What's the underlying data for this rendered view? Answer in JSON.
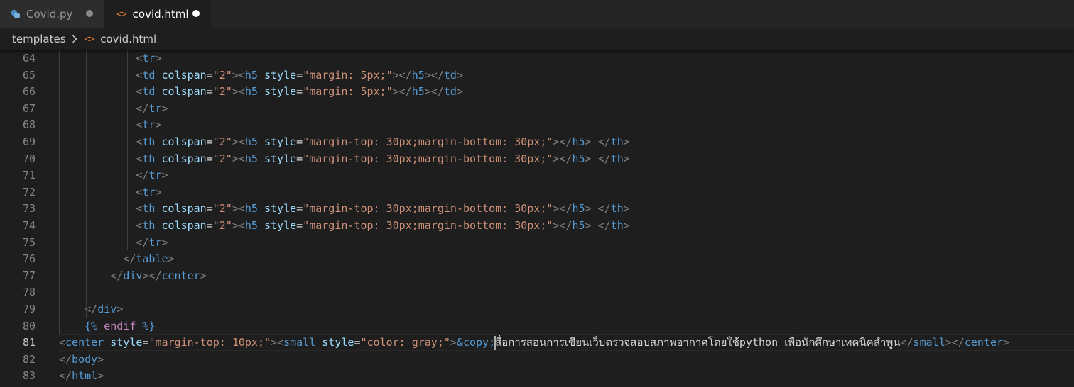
{
  "tabs": [
    {
      "label": "Covid.py",
      "icon": "python-file-icon",
      "active": false,
      "dirty": true
    },
    {
      "label": "covid.html",
      "icon": "html-file-icon",
      "active": true,
      "dirty": true
    }
  ],
  "breadcrumb": {
    "folder": "templates",
    "file": "covid.html"
  },
  "icons": {
    "html": "<>"
  },
  "editor": {
    "current_line": 81,
    "lines": [
      {
        "n": "64",
        "indent": 12,
        "tokens": [
          [
            "p",
            "<"
          ],
          [
            "tag",
            "tr"
          ],
          [
            "p",
            ">"
          ]
        ]
      },
      {
        "n": "65",
        "indent": 12,
        "tokens": [
          [
            "p",
            "<"
          ],
          [
            "tag",
            "td"
          ],
          [
            "t",
            " "
          ],
          [
            "attr",
            "colspan"
          ],
          [
            "t",
            "="
          ],
          [
            "str",
            "\"2\""
          ],
          [
            "p",
            "><"
          ],
          [
            "tag",
            "h5"
          ],
          [
            "t",
            " "
          ],
          [
            "attr",
            "style"
          ],
          [
            "t",
            "="
          ],
          [
            "str",
            "\"margin: 5px;\""
          ],
          [
            "p",
            "></"
          ],
          [
            "tag",
            "h5"
          ],
          [
            "p",
            "></"
          ],
          [
            "tag",
            "td"
          ],
          [
            "p",
            ">"
          ]
        ]
      },
      {
        "n": "66",
        "indent": 12,
        "tokens": [
          [
            "p",
            "<"
          ],
          [
            "tag",
            "td"
          ],
          [
            "t",
            " "
          ],
          [
            "attr",
            "colspan"
          ],
          [
            "t",
            "="
          ],
          [
            "str",
            "\"2\""
          ],
          [
            "p",
            "><"
          ],
          [
            "tag",
            "h5"
          ],
          [
            "t",
            " "
          ],
          [
            "attr",
            "style"
          ],
          [
            "t",
            "="
          ],
          [
            "str",
            "\"margin: 5px;\""
          ],
          [
            "p",
            "></"
          ],
          [
            "tag",
            "h5"
          ],
          [
            "p",
            "></"
          ],
          [
            "tag",
            "td"
          ],
          [
            "p",
            ">"
          ]
        ]
      },
      {
        "n": "67",
        "indent": 12,
        "tokens": [
          [
            "p",
            "</"
          ],
          [
            "tag",
            "tr"
          ],
          [
            "p",
            ">"
          ]
        ]
      },
      {
        "n": "68",
        "indent": 12,
        "tokens": [
          [
            "p",
            "<"
          ],
          [
            "tag",
            "tr"
          ],
          [
            "p",
            ">"
          ]
        ]
      },
      {
        "n": "69",
        "indent": 12,
        "tokens": [
          [
            "p",
            "<"
          ],
          [
            "tag",
            "th"
          ],
          [
            "t",
            " "
          ],
          [
            "attr",
            "colspan"
          ],
          [
            "t",
            "="
          ],
          [
            "str",
            "\"2\""
          ],
          [
            "p",
            "><"
          ],
          [
            "tag",
            "h5"
          ],
          [
            "t",
            " "
          ],
          [
            "attr",
            "style"
          ],
          [
            "t",
            "="
          ],
          [
            "str",
            "\"margin-top: 30px;margin-bottom: 30px;\""
          ],
          [
            "p",
            "></"
          ],
          [
            "tag",
            "h5"
          ],
          [
            "p",
            ">"
          ],
          [
            "t",
            " "
          ],
          [
            "p",
            "</"
          ],
          [
            "tag",
            "th"
          ],
          [
            "p",
            ">"
          ]
        ]
      },
      {
        "n": "70",
        "indent": 12,
        "tokens": [
          [
            "p",
            "<"
          ],
          [
            "tag",
            "th"
          ],
          [
            "t",
            " "
          ],
          [
            "attr",
            "colspan"
          ],
          [
            "t",
            "="
          ],
          [
            "str",
            "\"2\""
          ],
          [
            "p",
            "><"
          ],
          [
            "tag",
            "h5"
          ],
          [
            "t",
            " "
          ],
          [
            "attr",
            "style"
          ],
          [
            "t",
            "="
          ],
          [
            "str",
            "\"margin-top: 30px;margin-bottom: 30px;\""
          ],
          [
            "p",
            "></"
          ],
          [
            "tag",
            "h5"
          ],
          [
            "p",
            ">"
          ],
          [
            "t",
            " "
          ],
          [
            "p",
            "</"
          ],
          [
            "tag",
            "th"
          ],
          [
            "p",
            ">"
          ]
        ]
      },
      {
        "n": "71",
        "indent": 12,
        "tokens": [
          [
            "p",
            "</"
          ],
          [
            "tag",
            "tr"
          ],
          [
            "p",
            ">"
          ]
        ]
      },
      {
        "n": "72",
        "indent": 12,
        "tokens": [
          [
            "p",
            "<"
          ],
          [
            "tag",
            "tr"
          ],
          [
            "p",
            ">"
          ]
        ]
      },
      {
        "n": "73",
        "indent": 12,
        "tokens": [
          [
            "p",
            "<"
          ],
          [
            "tag",
            "th"
          ],
          [
            "t",
            " "
          ],
          [
            "attr",
            "colspan"
          ],
          [
            "t",
            "="
          ],
          [
            "str",
            "\"2\""
          ],
          [
            "p",
            "><"
          ],
          [
            "tag",
            "h5"
          ],
          [
            "t",
            " "
          ],
          [
            "attr",
            "style"
          ],
          [
            "t",
            "="
          ],
          [
            "str",
            "\"margin-top: 30px;margin-bottom: 30px;\""
          ],
          [
            "p",
            "></"
          ],
          [
            "tag",
            "h5"
          ],
          [
            "p",
            ">"
          ],
          [
            "t",
            " "
          ],
          [
            "p",
            "</"
          ],
          [
            "tag",
            "th"
          ],
          [
            "p",
            ">"
          ]
        ]
      },
      {
        "n": "74",
        "indent": 12,
        "tokens": [
          [
            "p",
            "<"
          ],
          [
            "tag",
            "th"
          ],
          [
            "t",
            " "
          ],
          [
            "attr",
            "colspan"
          ],
          [
            "t",
            "="
          ],
          [
            "str",
            "\"2\""
          ],
          [
            "p",
            "><"
          ],
          [
            "tag",
            "h5"
          ],
          [
            "t",
            " "
          ],
          [
            "attr",
            "style"
          ],
          [
            "t",
            "="
          ],
          [
            "str",
            "\"margin-top: 30px;margin-bottom: 30px;\""
          ],
          [
            "p",
            "></"
          ],
          [
            "tag",
            "h5"
          ],
          [
            "p",
            ">"
          ],
          [
            "t",
            " "
          ],
          [
            "p",
            "</"
          ],
          [
            "tag",
            "th"
          ],
          [
            "p",
            ">"
          ]
        ]
      },
      {
        "n": "75",
        "indent": 12,
        "tokens": [
          [
            "p",
            "</"
          ],
          [
            "tag",
            "tr"
          ],
          [
            "p",
            ">"
          ]
        ]
      },
      {
        "n": "76",
        "indent": 10,
        "tokens": [
          [
            "p",
            "</"
          ],
          [
            "tag",
            "table"
          ],
          [
            "p",
            ">"
          ]
        ]
      },
      {
        "n": "77",
        "indent": 8,
        "tokens": [
          [
            "p",
            "</"
          ],
          [
            "tag",
            "div"
          ],
          [
            "p",
            "></"
          ],
          [
            "tag",
            "center"
          ],
          [
            "p",
            ">"
          ]
        ]
      },
      {
        "n": "78",
        "indent": 0,
        "tokens": []
      },
      {
        "n": "79",
        "indent": 4,
        "tokens": [
          [
            "p",
            "</"
          ],
          [
            "tag",
            "div"
          ],
          [
            "p",
            ">"
          ]
        ]
      },
      {
        "n": "80",
        "indent": 4,
        "tokens": [
          [
            "tmpl",
            "{%"
          ],
          [
            "t",
            " "
          ],
          [
            "kw",
            "endif"
          ],
          [
            "t",
            " "
          ],
          [
            "tmpl",
            "%}"
          ]
        ]
      },
      {
        "n": "81",
        "indent": 0,
        "tokens": [
          [
            "p",
            "<"
          ],
          [
            "tag",
            "center"
          ],
          [
            "t",
            " "
          ],
          [
            "attr",
            "style"
          ],
          [
            "t",
            "="
          ],
          [
            "str",
            "\"margin-top: 10px;\""
          ],
          [
            "p",
            "><"
          ],
          [
            "tag",
            "small"
          ],
          [
            "t",
            " "
          ],
          [
            "attr",
            "style"
          ],
          [
            "t",
            "="
          ],
          [
            "str",
            "\"color: gray;\""
          ],
          [
            "p",
            ">"
          ],
          [
            "ent",
            "&copy;"
          ],
          [
            "caret",
            ""
          ],
          [
            "txt",
            "สื่อการสอนการเขียนเว็บตรวจสอบสภาพอากาศโดยใช้python เพื่อนักศึกษาเทคนิคลำพูน"
          ],
          [
            "p",
            "</"
          ],
          [
            "tag",
            "small"
          ],
          [
            "p",
            "></"
          ],
          [
            "tag",
            "center"
          ],
          [
            "p",
            ">"
          ]
        ]
      },
      {
        "n": "82",
        "indent": 0,
        "tokens": [
          [
            "p",
            "</"
          ],
          [
            "tag",
            "body"
          ],
          [
            "p",
            ">"
          ]
        ]
      },
      {
        "n": "83",
        "indent": 0,
        "tokens": [
          [
            "p",
            "</"
          ],
          [
            "tag",
            "html"
          ],
          [
            "p",
            ">"
          ]
        ]
      }
    ]
  }
}
